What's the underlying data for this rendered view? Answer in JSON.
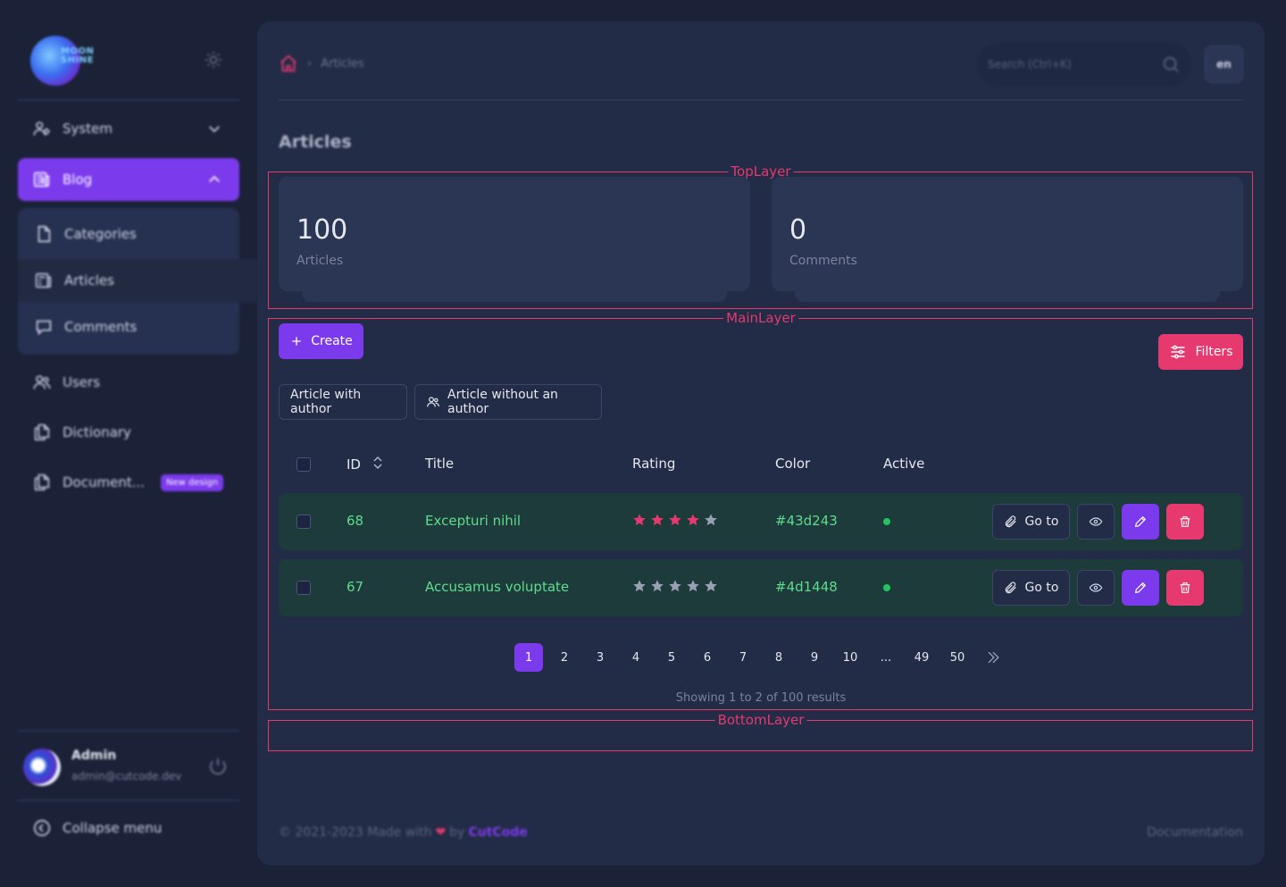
{
  "sidebar": {
    "logo_text_line1": "MOON",
    "logo_text_line2": "SHINE",
    "menu": [
      {
        "label": "System",
        "icon": "users-gear-icon",
        "expanded": false
      },
      {
        "label": "Blog",
        "icon": "newspaper-icon",
        "expanded": true,
        "active": true
      },
      {
        "label": "Users",
        "icon": "users-icon"
      },
      {
        "label": "Dictionary",
        "icon": "documents-icon"
      },
      {
        "label": "Document...",
        "icon": "documents-icon",
        "badge": "New design"
      }
    ],
    "blog_submenu": [
      {
        "label": "Categories",
        "icon": "document-icon"
      },
      {
        "label": "Articles",
        "icon": "newspaper-icon",
        "active": true
      },
      {
        "label": "Comments",
        "icon": "chat-icon"
      }
    ],
    "user": {
      "name": "Admin",
      "email": "admin@cutcode.dev"
    },
    "collapse_label": "Collapse menu"
  },
  "header": {
    "breadcrumb_current": "Articles",
    "search_placeholder": "Search (Ctrl+K)",
    "language": "en"
  },
  "page_title": "Articles",
  "layers": {
    "top": "TopLayer",
    "main": "MainLayer",
    "bottom": "BottomLayer"
  },
  "metrics": [
    {
      "value": "100",
      "label": "Articles"
    },
    {
      "value": "0",
      "label": "Comments"
    }
  ],
  "buttons": {
    "create": "Create",
    "filters": "Filters",
    "with_author": "Article with author",
    "without_author": "Article without an author"
  },
  "table": {
    "columns": [
      "ID",
      "Title",
      "Rating",
      "Color",
      "Active"
    ],
    "rows": [
      {
        "id": "68",
        "title": "Excepturi nihil",
        "rating": 4,
        "color": "#43d243",
        "active": true
      },
      {
        "id": "67",
        "title": "Accusamus voluptate",
        "rating": 0,
        "color": "#4d1448",
        "active": true
      }
    ],
    "goto_label": "Go to"
  },
  "pagination": {
    "pages": [
      "1",
      "2",
      "3",
      "4",
      "5",
      "6",
      "7",
      "8",
      "9",
      "10",
      "...",
      "49",
      "50"
    ],
    "current": "1",
    "summary": "Showing 1 to 2 of 100 results"
  },
  "footer": {
    "copyright": "© 2021-2023 Made with",
    "by": "by",
    "brand": "CutCode",
    "documentation": "Documentation"
  },
  "colors": {
    "accent": "#7c3aed",
    "danger": "#e5396f",
    "success": "#22c55e",
    "star_on": "#e5396f",
    "star_off": "#9aa0b4"
  }
}
